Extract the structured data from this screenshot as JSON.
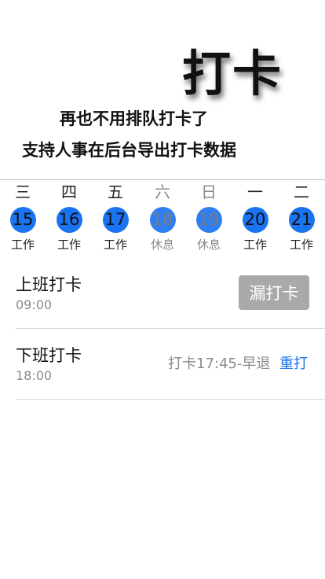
{
  "hero": {
    "title": "打卡",
    "tagline_1": "再也不用排队打卡了",
    "tagline_2": "支持人事在后台导出打卡数据"
  },
  "week": [
    {
      "weekday": "三",
      "date": "15",
      "status": "工作",
      "rest": false
    },
    {
      "weekday": "四",
      "date": "16",
      "status": "工作",
      "rest": false
    },
    {
      "weekday": "五",
      "date": "17",
      "status": "工作",
      "rest": false
    },
    {
      "weekday": "六",
      "date": "18",
      "status": "休息",
      "rest": true
    },
    {
      "weekday": "日",
      "date": "19",
      "status": "休息",
      "rest": true
    },
    {
      "weekday": "一",
      "date": "20",
      "status": "工作",
      "rest": false
    },
    {
      "weekday": "二",
      "date": "21",
      "status": "工作",
      "rest": false
    }
  ],
  "clock_in": {
    "title": "上班打卡",
    "time": "09:00",
    "button_label": "漏打卡"
  },
  "clock_out": {
    "title": "下班打卡",
    "time": "18:00",
    "record": "打卡17:45-早退",
    "redo_label": "重打"
  },
  "colors": {
    "accent": "#1a73f0",
    "muted": "#8a8a8a",
    "button_disabled": "#a9a9a9"
  }
}
